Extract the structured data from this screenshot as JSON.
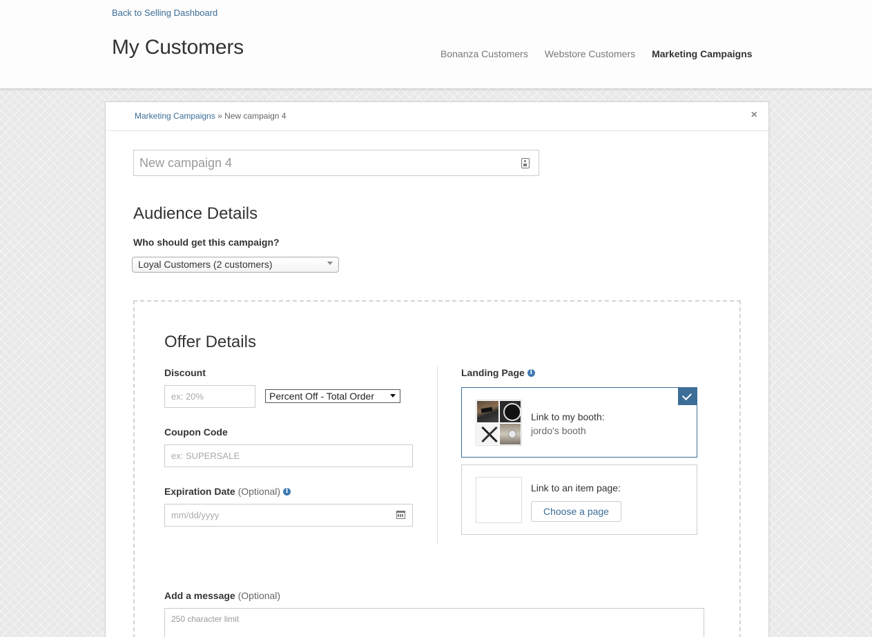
{
  "header": {
    "back_link": "Back to Selling Dashboard",
    "title": "My Customers",
    "nav": [
      {
        "label": "Bonanza Customers",
        "active": false
      },
      {
        "label": "Webstore Customers",
        "active": false
      },
      {
        "label": "Marketing Campaigns",
        "active": true
      }
    ]
  },
  "panel": {
    "breadcrumb": {
      "parent": "Marketing Campaigns",
      "separator": "»",
      "current": "New campaign 4"
    },
    "close": "×",
    "campaign_name": {
      "value": "New campaign 4"
    }
  },
  "audience": {
    "heading": "Audience Details",
    "question": "Who should get this campaign?",
    "selected": "Loyal Customers (2 customers)"
  },
  "offer": {
    "heading": "Offer Details",
    "discount": {
      "label": "Discount",
      "placeholder": "ex: 20%",
      "type_selected": "Percent Off - Total Order"
    },
    "coupon": {
      "label": "Coupon Code",
      "placeholder": "ex: SUPERSALE"
    },
    "expiration": {
      "label": "Expiration Date",
      "optional": "(Optional)",
      "placeholder": "mm/dd/yyyy"
    },
    "landing_page": {
      "label": "Landing Page",
      "booth_option": {
        "title": "Link to my booth:",
        "subtitle": "jordo's booth",
        "selected": true
      },
      "item_option": {
        "title": "Link to an item page:",
        "button": "Choose a page",
        "selected": false
      }
    },
    "message": {
      "label": "Add a message",
      "optional": "(Optional)",
      "placeholder": "250 character limit"
    }
  },
  "colors": {
    "accent": "#3c6d96",
    "info": "#3e78b2"
  }
}
